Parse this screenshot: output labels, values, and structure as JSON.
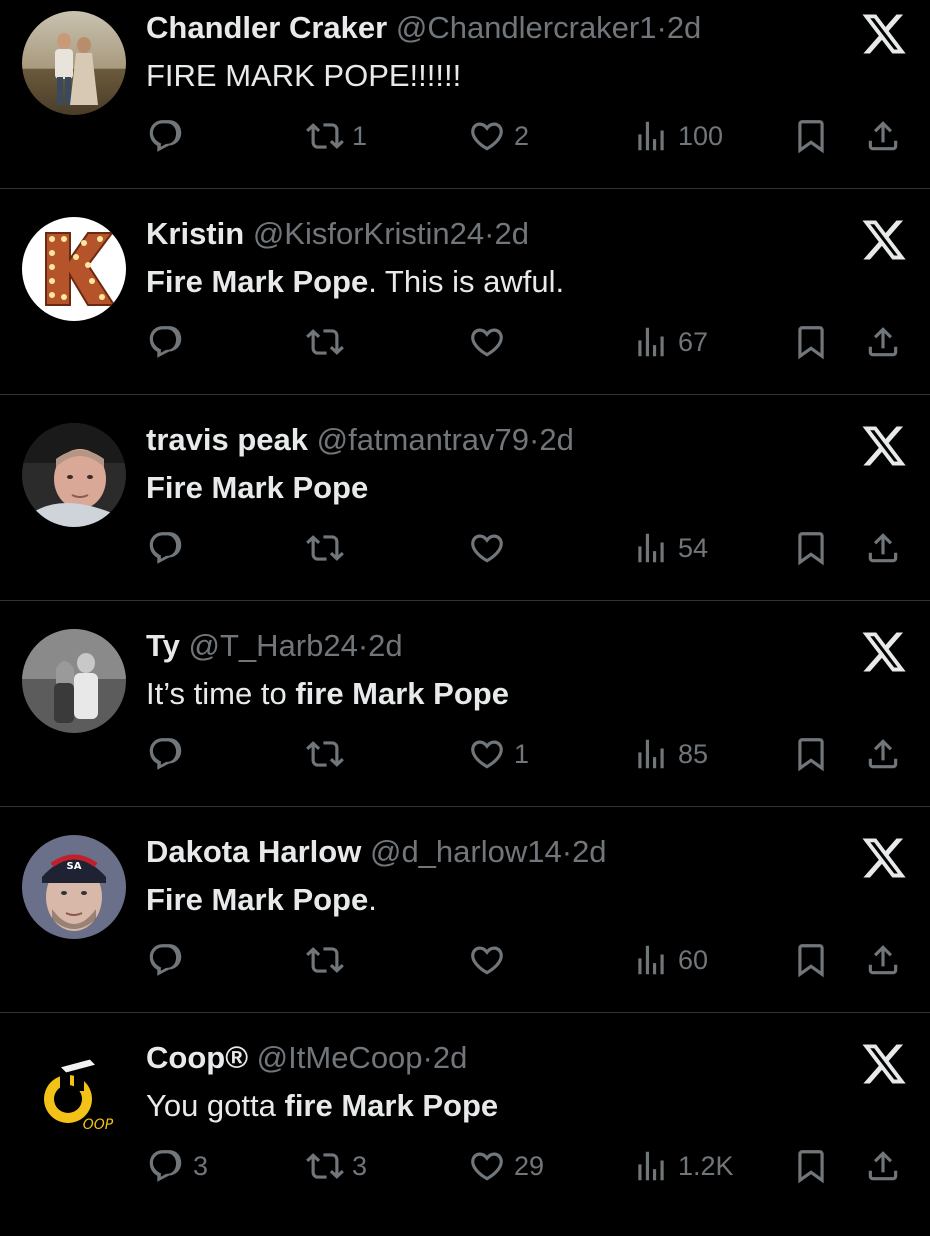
{
  "tweets": [
    {
      "name": "Chandler Craker",
      "handle": "@Chandlercraker1",
      "time": "2d",
      "text": [
        {
          "t": "FIRE MARK POPE!!!!!!",
          "bold": false
        }
      ],
      "replies": "",
      "retweets": "1",
      "likes": "2",
      "views": "100",
      "avatar": "couple-photo"
    },
    {
      "name": "Kristin",
      "handle": "@KisforKristin24",
      "time": "2d",
      "text": [
        {
          "t": "Fire Mark Pope",
          "bold": true
        },
        {
          "t": ". This is awful.",
          "bold": false
        }
      ],
      "replies": "",
      "retweets": "",
      "likes": "",
      "views": "67",
      "avatar": "marquee-letter-k"
    },
    {
      "name": "travis peak",
      "handle": "@fatmantrav79",
      "time": "2d",
      "text": [
        {
          "t": "Fire Mark Pope",
          "bold": true
        }
      ],
      "replies": "",
      "retweets": "",
      "likes": "",
      "views": "54",
      "avatar": "man-selfie"
    },
    {
      "name": "Ty",
      "handle": "@T_Harb24",
      "time": "2d",
      "text": [
        {
          "t": "It’s time to ",
          "bold": false
        },
        {
          "t": "fire Mark Pope",
          "bold": true
        }
      ],
      "replies": "",
      "retweets": "",
      "likes": "1",
      "views": "85",
      "avatar": "couple-bw"
    },
    {
      "name": "Dakota Harlow",
      "handle": "@d_harlow14",
      "time": "2d",
      "text": [
        {
          "t": "Fire Mark Pope",
          "bold": true
        },
        {
          "t": ".",
          "bold": false
        }
      ],
      "replies": "",
      "retweets": "",
      "likes": "",
      "views": "60",
      "avatar": "man-cap"
    },
    {
      "name": "Coop®",
      "handle": "@ItMeCoop",
      "time": "2d",
      "text": [
        {
          "t": "You gotta ",
          "bold": false
        },
        {
          "t": "fire Mark Pope",
          "bold": true
        }
      ],
      "replies": "3",
      "retweets": "3",
      "likes": "29",
      "views": "1.2K",
      "avatar": "coop-logo",
      "avatar_text": "OOP"
    }
  ],
  "colors": {
    "background": "#000000",
    "primary_text": "#e7e9ea",
    "secondary_text": "#71767b",
    "divider": "#2f3336"
  }
}
